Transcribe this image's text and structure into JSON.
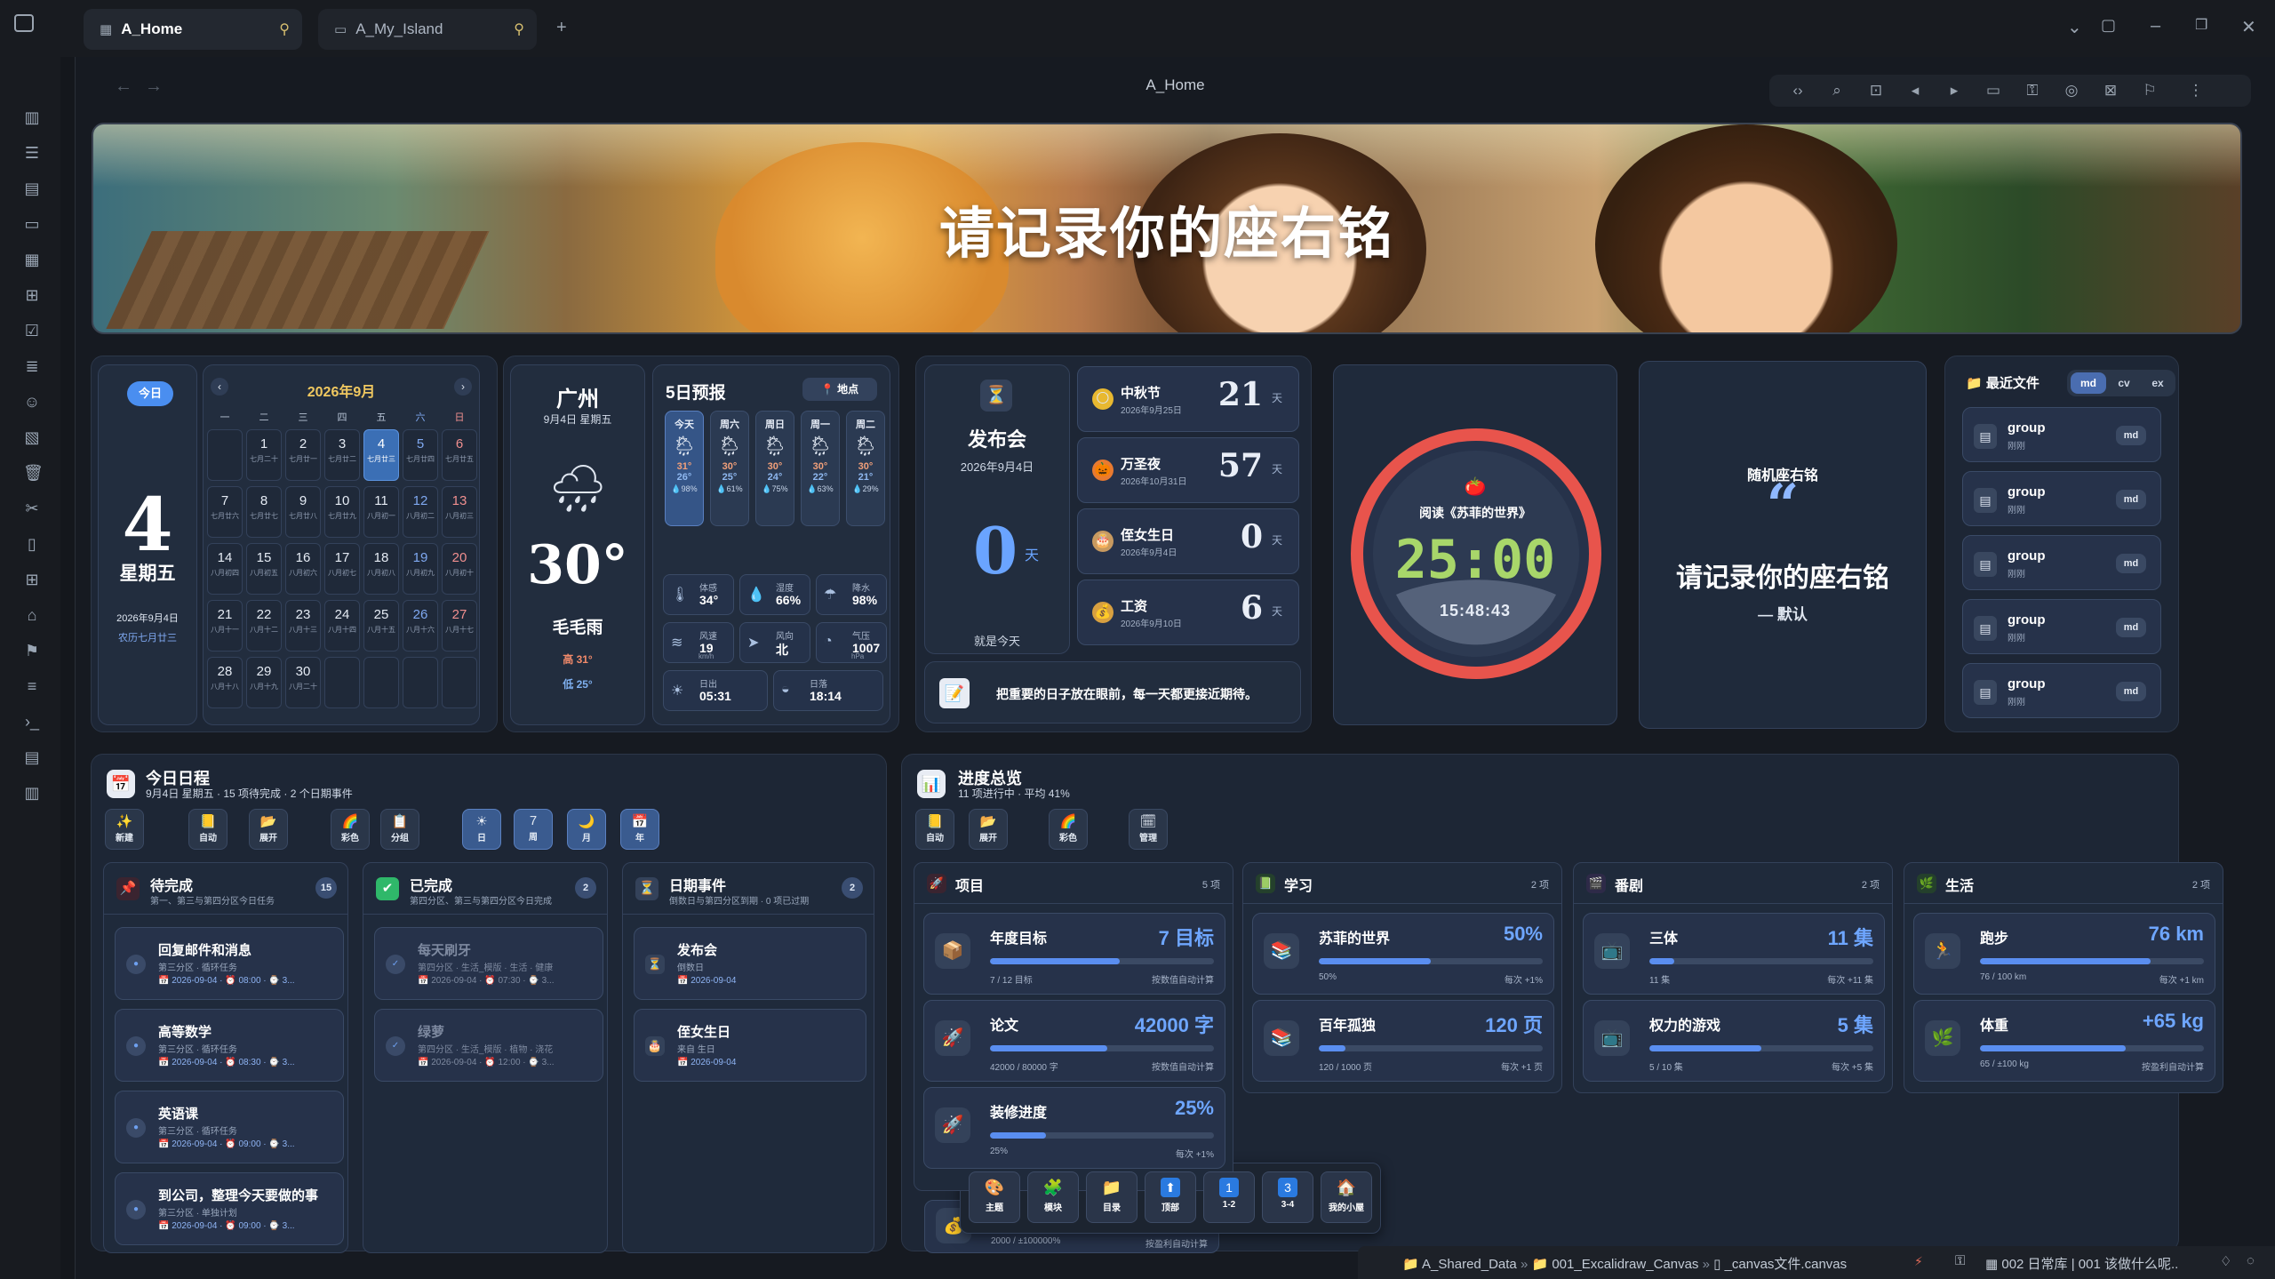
{
  "tabs": [
    {
      "label": "A_Home"
    },
    {
      "label": "A_My_Island"
    }
  ],
  "view_title": "A_Home",
  "banner": {
    "motto": "请记录你的座右铭"
  },
  "today_card": {
    "btn": "今日",
    "day": "4",
    "weekday": "星期五",
    "date": "2026年9月4日",
    "lunar": "农历七月廿三"
  },
  "calendar": {
    "title": "2026年9月",
    "dows": [
      "一",
      "二",
      "三",
      "四",
      "五",
      "六",
      "日"
    ],
    "cells": [
      {
        "d": "1",
        "l": "七月二十"
      },
      {
        "d": "2",
        "l": "七月廿一"
      },
      {
        "d": "3",
        "l": "七月廿二"
      },
      {
        "d": "4",
        "l": "七月廿三"
      },
      {
        "d": "5",
        "l": "七月廿四"
      },
      {
        "d": "6",
        "l": "七月廿五"
      },
      {
        "d": "7",
        "l": "七月廿六"
      },
      {
        "d": "8",
        "l": "七月廿七"
      },
      {
        "d": "9",
        "l": "七月廿八"
      },
      {
        "d": "10",
        "l": "七月廿九"
      },
      {
        "d": "11",
        "l": "八月初一"
      },
      {
        "d": "12",
        "l": "八月初二"
      },
      {
        "d": "13",
        "l": "八月初三"
      },
      {
        "d": "14",
        "l": "八月初四"
      },
      {
        "d": "15",
        "l": "八月初五"
      },
      {
        "d": "16",
        "l": "八月初六"
      },
      {
        "d": "17",
        "l": "八月初七"
      },
      {
        "d": "18",
        "l": "八月初八"
      },
      {
        "d": "19",
        "l": "八月初九"
      },
      {
        "d": "20",
        "l": "八月初十"
      },
      {
        "d": "21",
        "l": "八月十一"
      },
      {
        "d": "22",
        "l": "八月十二"
      },
      {
        "d": "23",
        "l": "八月十三"
      },
      {
        "d": "24",
        "l": "八月十四"
      },
      {
        "d": "25",
        "l": "八月十五"
      },
      {
        "d": "26",
        "l": "八月十六"
      },
      {
        "d": "27",
        "l": "八月十七"
      },
      {
        "d": "28",
        "l": "八月十八"
      },
      {
        "d": "29",
        "l": "八月十九"
      },
      {
        "d": "30",
        "l": "八月二十"
      }
    ]
  },
  "weather": {
    "city": "广州",
    "date": "9月4日 星期五",
    "temp": "30°",
    "desc": "毛毛雨",
    "high": "高 31°",
    "low": "低 25°",
    "forecast_title": "5日预报",
    "location_btn": "地点",
    "days": [
      {
        "n": "今天",
        "hi": "31°",
        "lo": "26°",
        "rp": "💧98%"
      },
      {
        "n": "周六",
        "hi": "30°",
        "lo": "25°",
        "rp": "💧61%"
      },
      {
        "n": "周日",
        "hi": "30°",
        "lo": "24°",
        "rp": "💧75%"
      },
      {
        "n": "周一",
        "hi": "30°",
        "lo": "22°",
        "rp": "💧63%"
      },
      {
        "n": "周二",
        "hi": "30°",
        "lo": "21°",
        "rp": "💧29%"
      }
    ],
    "details": [
      {
        "t": "体感",
        "v": "34°",
        "i": "🌡"
      },
      {
        "t": "湿度",
        "v": "66%",
        "i": "💧"
      },
      {
        "t": "降水",
        "v": "98%",
        "i": "☂"
      },
      {
        "t": "风速",
        "v": "19",
        "i": "≋"
      },
      {
        "t": "风向",
        "v": "北",
        "i": "➤"
      },
      {
        "t": "气压",
        "v": "1007",
        "i": "◔"
      }
    ],
    "wind_unit": "km/h",
    "pressure_unit": "hPa",
    "sunrise": {
      "t": "日出",
      "v": "05:31"
    },
    "sunset": {
      "t": "日落",
      "v": "18:14"
    }
  },
  "countdown": {
    "main": {
      "name": "发布会",
      "date": "2026年9月4日",
      "num": "0",
      "unit": "天",
      "note": "就是今天"
    },
    "events": [
      {
        "name": "中秋节",
        "date": "2026年9月25日",
        "num": "21",
        "unit": "天",
        "icon": "🌕"
      },
      {
        "name": "万圣夜",
        "date": "2026年10月31日",
        "num": "57",
        "unit": "天",
        "icon": "🎃"
      },
      {
        "name": "侄女生日",
        "date": "2026年9月4日",
        "num": "0",
        "unit": "天",
        "icon": "🎂"
      },
      {
        "name": "工资",
        "date": "2026年9月10日",
        "num": "6",
        "unit": "天",
        "icon": "💰"
      }
    ],
    "quote": "把重要的日子放在眼前，每一天都更接近期待。"
  },
  "pomodoro": {
    "label": "阅读《苏菲的世界》",
    "time": "25:00",
    "clock": "15:48:43"
  },
  "random_motto": {
    "title": "随机座右铭",
    "quote_mark": "“",
    "text": "请记录你的座右铭",
    "author": "— 默认"
  },
  "recent": {
    "title": "最近文件",
    "tabs": [
      "md",
      "cv",
      "ex"
    ],
    "files": [
      {
        "name": "group",
        "sub": "刚刚",
        "tag": "md"
      },
      {
        "name": "group",
        "sub": "刚刚",
        "tag": "md"
      },
      {
        "name": "group",
        "sub": "刚刚",
        "tag": "md"
      },
      {
        "name": "group",
        "sub": "刚刚",
        "tag": "md"
      },
      {
        "name": "group",
        "sub": "刚刚",
        "tag": "md"
      }
    ]
  },
  "schedule": {
    "title": "今日日程",
    "sub": "9月4日 星期五 · 15 项待完成 · 2 个日期事件",
    "buttons": [
      {
        "i": "✨",
        "t": "新建"
      },
      {
        "i": "📒",
        "t": "自动"
      },
      {
        "i": "📂",
        "t": "展开"
      },
      {
        "i": "🌈",
        "t": "彩色"
      },
      {
        "i": "📋",
        "t": "分组"
      },
      {
        "i": "☀",
        "t": "日"
      },
      {
        "i": "7",
        "t": "周"
      },
      {
        "i": "🌙",
        "t": "月"
      },
      {
        "i": "📅",
        "t": "年"
      }
    ],
    "pending": {
      "title": "待完成",
      "sub": "第一、第三与第四分区今日任务",
      "count": "15",
      "items": [
        {
          "t": "回复邮件和消息",
          "s": "第三分区 · 循环任务",
          "m": "📅 2026-09-04 · ⏰ 08:00 · ⌚ 3..."
        },
        {
          "t": "高等数学",
          "s": "第三分区 · 循环任务",
          "m": "📅 2026-09-04 · ⏰ 08:30 · ⌚ 3..."
        },
        {
          "t": "英语课",
          "s": "第三分区 · 循环任务",
          "m": "📅 2026-09-04 · ⏰ 09:00 · ⌚ 3..."
        },
        {
          "t": "到公司，整理今天要做的事",
          "s": "第三分区 · 单独计划",
          "m": "📅 2026-09-04 · ⏰ 09:00 · ⌚ 3..."
        }
      ]
    },
    "done": {
      "title": "已完成",
      "sub": "第四分区、第三与第四分区今日完成",
      "count": "2",
      "items": [
        {
          "t": "每天刷牙",
          "s": "第四分区 · 生活_模版 · 生活 · 健康",
          "m": "📅 2026-09-04 · ⏰ 07:30 · ⌚ 3..."
        },
        {
          "t": "绿萝",
          "s": "第四分区 · 生活_模版 · 植物 · 浇花",
          "m": "📅 2026-09-04 · ⏰ 12:00 · ⌚ 3..."
        }
      ]
    },
    "events": {
      "title": "日期事件",
      "sub": "倒数日与第四分区到期 · 0 项已过期",
      "count": "2",
      "items": [
        {
          "t": "发布会",
          "s": "倒数日",
          "m": "📅 2026-09-04",
          "i": "⏳"
        },
        {
          "t": "侄女生日",
          "s": "来自 生日",
          "m": "📅 2026-09-04",
          "i": "🎂"
        }
      ]
    }
  },
  "progress": {
    "title": "进度总览",
    "sub": "11 项进行中 · 平均 41%",
    "buttons": [
      {
        "i": "📒",
        "t": "自动"
      },
      {
        "i": "📂",
        "t": "展开"
      },
      {
        "i": "🌈",
        "t": "彩色"
      },
      {
        "i": "🗓",
        "t": "管理"
      }
    ],
    "groups": [
      {
        "title": "项目",
        "count": "5 项",
        "icon": "🚀",
        "items": [
          {
            "n": "年度目标",
            "v": "7 目标",
            "pct": 0.58,
            "l": "7 / 12 目标",
            "r": "按数值自动计算",
            "i": "📦"
          },
          {
            "n": "论文",
            "v": "42000 字",
            "pct": 0.525,
            "l": "42000 / 80000 字",
            "r": "按数值自动计算",
            "i": "🚀"
          },
          {
            "n": "装修进度",
            "v": "25%",
            "pct": 0.25,
            "l": "25%",
            "r": "每次 +1%",
            "i": "🚀"
          }
        ]
      },
      {
        "title": "学习",
        "count": "2 项",
        "icon": "📗",
        "items": [
          {
            "n": "苏菲的世界",
            "v": "50%",
            "pct": 0.5,
            "l": "50%",
            "r": "每次 +1%",
            "i": "📚"
          },
          {
            "n": "百年孤独",
            "v": "120 页",
            "pct": 0.12,
            "l": "120 / 1000 页",
            "r": "每次 +1 页",
            "i": "📚"
          }
        ]
      },
      {
        "title": "番剧",
        "count": "2 项",
        "icon": "🎬",
        "items": [
          {
            "n": "三体",
            "v": "11 集",
            "pct": 0.11,
            "l": "11 集",
            "r": "每次 +11 集",
            "i": "📺"
          },
          {
            "n": "权力的游戏",
            "v": "5 集",
            "pct": 0.5,
            "l": "5 / 10 集",
            "r": "每次 +5 集",
            "i": "📺"
          }
        ]
      },
      {
        "title": "生活",
        "count": "2 项",
        "icon": "🌿",
        "items": [
          {
            "n": "跑步",
            "v": "76 km",
            "pct": 0.76,
            "l": "76 / 100 km",
            "r": "每次 +1 km",
            "i": "🏃"
          },
          {
            "n": "体重",
            "v": "+65 kg",
            "pct": 0.65,
            "l": "65 / ±100 kg",
            "r": "按盈利自动计算",
            "i": "🌿"
          }
        ]
      }
    ],
    "hidden_item": {
      "l": "2000 / ±100000%",
      "r": "按盈利自动计算"
    }
  },
  "float_toolbar": [
    {
      "i": "🎨",
      "t": "主题"
    },
    {
      "i": "🧩",
      "t": "模块"
    },
    {
      "i": "📁",
      "t": "目录"
    },
    {
      "i": "⬆",
      "t": "顶部"
    },
    {
      "i": "1",
      "t": "1-2"
    },
    {
      "i": "3",
      "t": "3-4"
    },
    {
      "i": "🏠",
      "t": "我的小屋"
    }
  ],
  "statusbar": {
    "path": [
      "A_Shared_Data",
      "001_Excalidraw_Canvas",
      "_canvas文件.canvas"
    ],
    "extra": "002 日常库 | 001 该做什么呢.."
  }
}
